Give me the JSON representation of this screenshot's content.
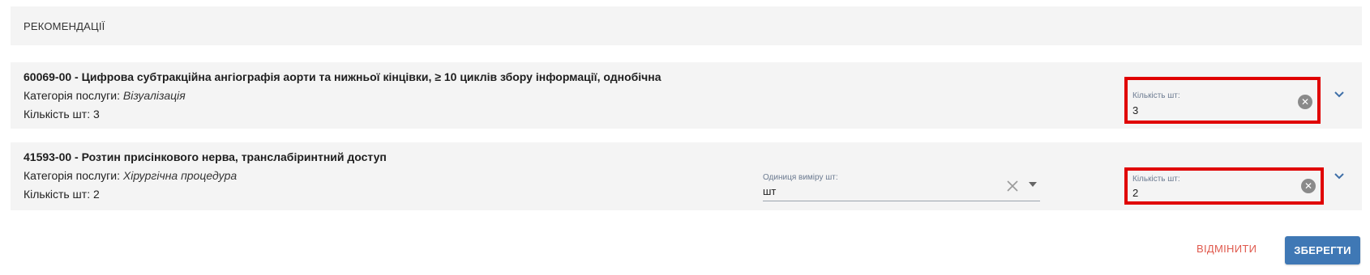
{
  "header": {
    "title": "РЕКОМЕНДАЦІЇ"
  },
  "items": [
    {
      "title": "60069-00 - Цифрова субтракційна ангіографія аорти та нижньої кінцівки, ≥ 10 циклів збору інформації, однобічна",
      "category_label": "Категорія послуги:",
      "category_value": "Візуалізація",
      "count_text": "Кількість шт: 3",
      "qty_label": "Кількість шт:",
      "qty_value": "3"
    },
    {
      "title": "41593-00 - Розтин присінкового нерва, транслабіринтний доступ",
      "category_label": "Категорія послуги:",
      "category_value": "Хірургічна процедура",
      "count_text": "Кількість шт: 2",
      "unit_label": "Одиниця виміру шт:",
      "unit_value": "шт",
      "qty_label": "Кількість шт:",
      "qty_value": "2"
    }
  ],
  "actions": {
    "cancel": "ВІДМІНИТИ",
    "save": "ЗБЕРЕГТИ"
  },
  "colors": {
    "highlight": "#e00000",
    "primary": "#3f78b5",
    "cancel": "#e05a4e"
  }
}
